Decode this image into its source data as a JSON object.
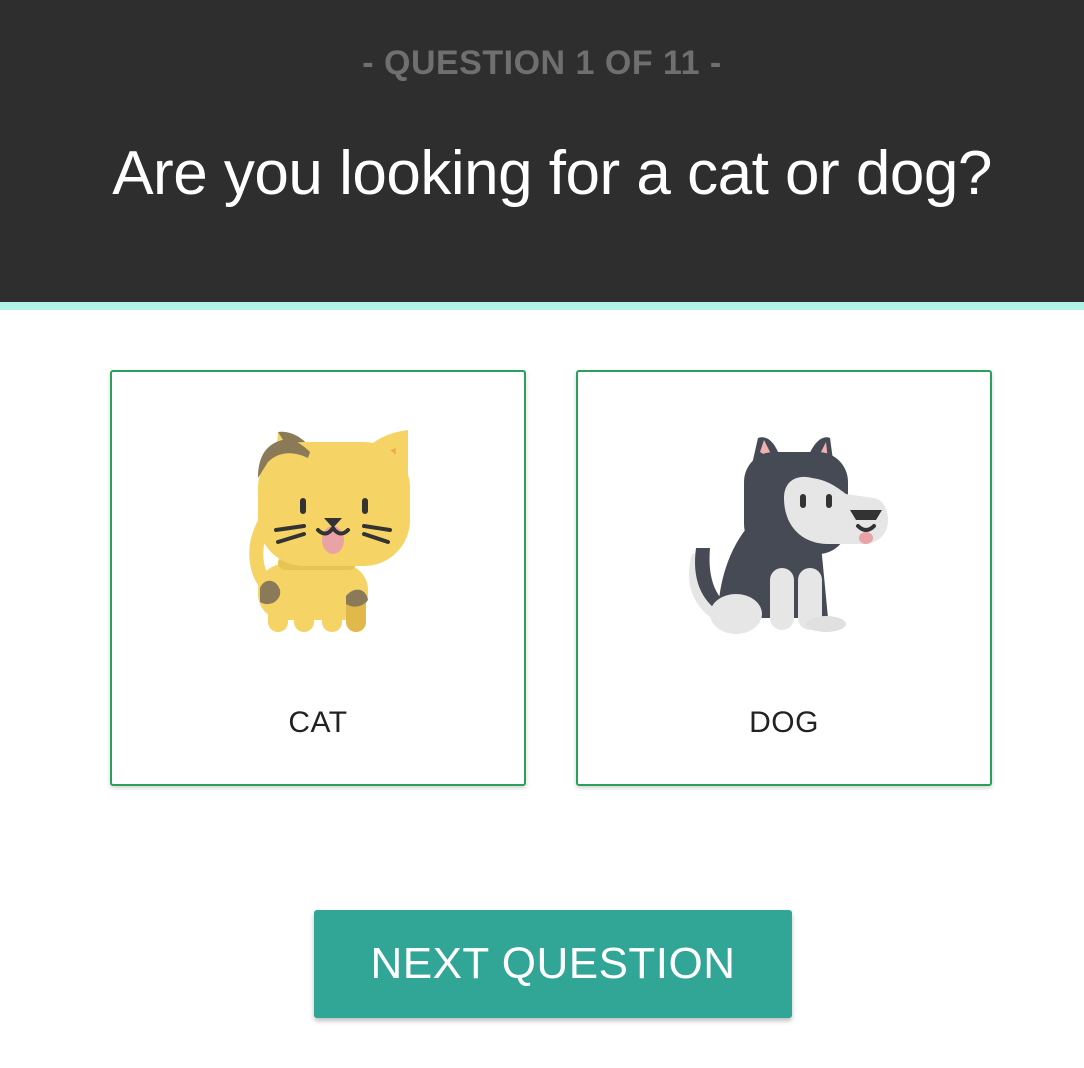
{
  "header": {
    "counter": "- QUESTION 1 OF 11 -",
    "question": "Are you looking for a cat or dog?"
  },
  "options": [
    {
      "label": "CAT",
      "icon": "cat-icon"
    },
    {
      "label": "DOG",
      "icon": "dog-icon"
    }
  ],
  "actions": {
    "next_label": "NEXT QUESTION"
  },
  "colors": {
    "header_bg": "#2e2e2e",
    "header_accent_border": "#b3f0e6",
    "card_border": "#2aa05a",
    "button_bg": "#31a596"
  }
}
